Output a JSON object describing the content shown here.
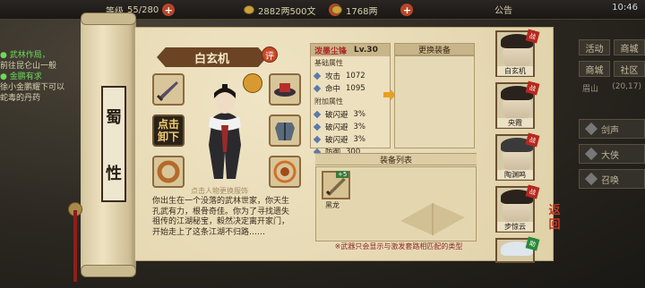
{
  "topbar": {
    "level": "等级",
    "energy": "55/280",
    "silver": "2882两500文",
    "gold": "1768两",
    "notice": "公告",
    "time": "10:46"
  },
  "quests": {
    "line1": "● 武林作局，",
    "line2": "前往昆仑山一般",
    "line3": "● 金鹏有求",
    "line4": "徐小金鹏耀下可以",
    "line5": "蛇毒的丹药"
  },
  "right_menu": {
    "rows": [
      [
        "活动",
        "商城"
      ],
      [
        "商城",
        "社区"
      ]
    ],
    "info_left": "眉山",
    "info_right": "(20,17)",
    "side": [
      "剑声",
      "大侠",
      "召唤"
    ]
  },
  "sect": [
    "蜀",
    "性"
  ],
  "character": {
    "name": "白玄机",
    "comment_badge": "评",
    "change_avatar_hint": "点击人物更换服饰",
    "unequip_label_1": "点击",
    "unequip_label_2": "卸下",
    "bio": [
      "你出生在一个没落的武林世家，你天生",
      "孔武有力，根骨奇佳。你为了寻找遗失",
      "祖传的江湖秘宝，毅然决定离开家门，",
      "开始走上了这条江湖不归路……"
    ]
  },
  "stats": {
    "item_name": "泼墨尘锋",
    "item_level": "Lv.30",
    "base_header": "基础属性",
    "base": [
      {
        "label": "攻击",
        "value": "1072"
      },
      {
        "label": "命中",
        "value": "1095"
      }
    ],
    "extra_header": "附加属性",
    "extra": [
      {
        "label": "破闪避",
        "value": "3%"
      },
      {
        "label": "破闪避",
        "value": "3%"
      },
      {
        "label": "破闪避",
        "value": "3%"
      },
      {
        "label": "防御",
        "value": "300"
      }
    ],
    "change_title": "更换装备"
  },
  "equipment": {
    "title": "装备列表",
    "items": [
      {
        "name": "黑龙",
        "badge": "+5"
      }
    ],
    "note": "※武器只会显示与激发套路相匹配的类型"
  },
  "party": [
    {
      "name": "白玄机",
      "tag": "战"
    },
    {
      "name": "央霞",
      "tag": "战"
    },
    {
      "name": "陶渊鸣",
      "tag": "战"
    },
    {
      "name": "步惊云",
      "tag": "战"
    },
    {
      "name": "",
      "tag": "助"
    }
  ],
  "back": [
    "返",
    "回"
  ],
  "colors": {
    "accent": "#b7281f",
    "paper": "#e8dcb8",
    "banner": "#6b4424"
  }
}
